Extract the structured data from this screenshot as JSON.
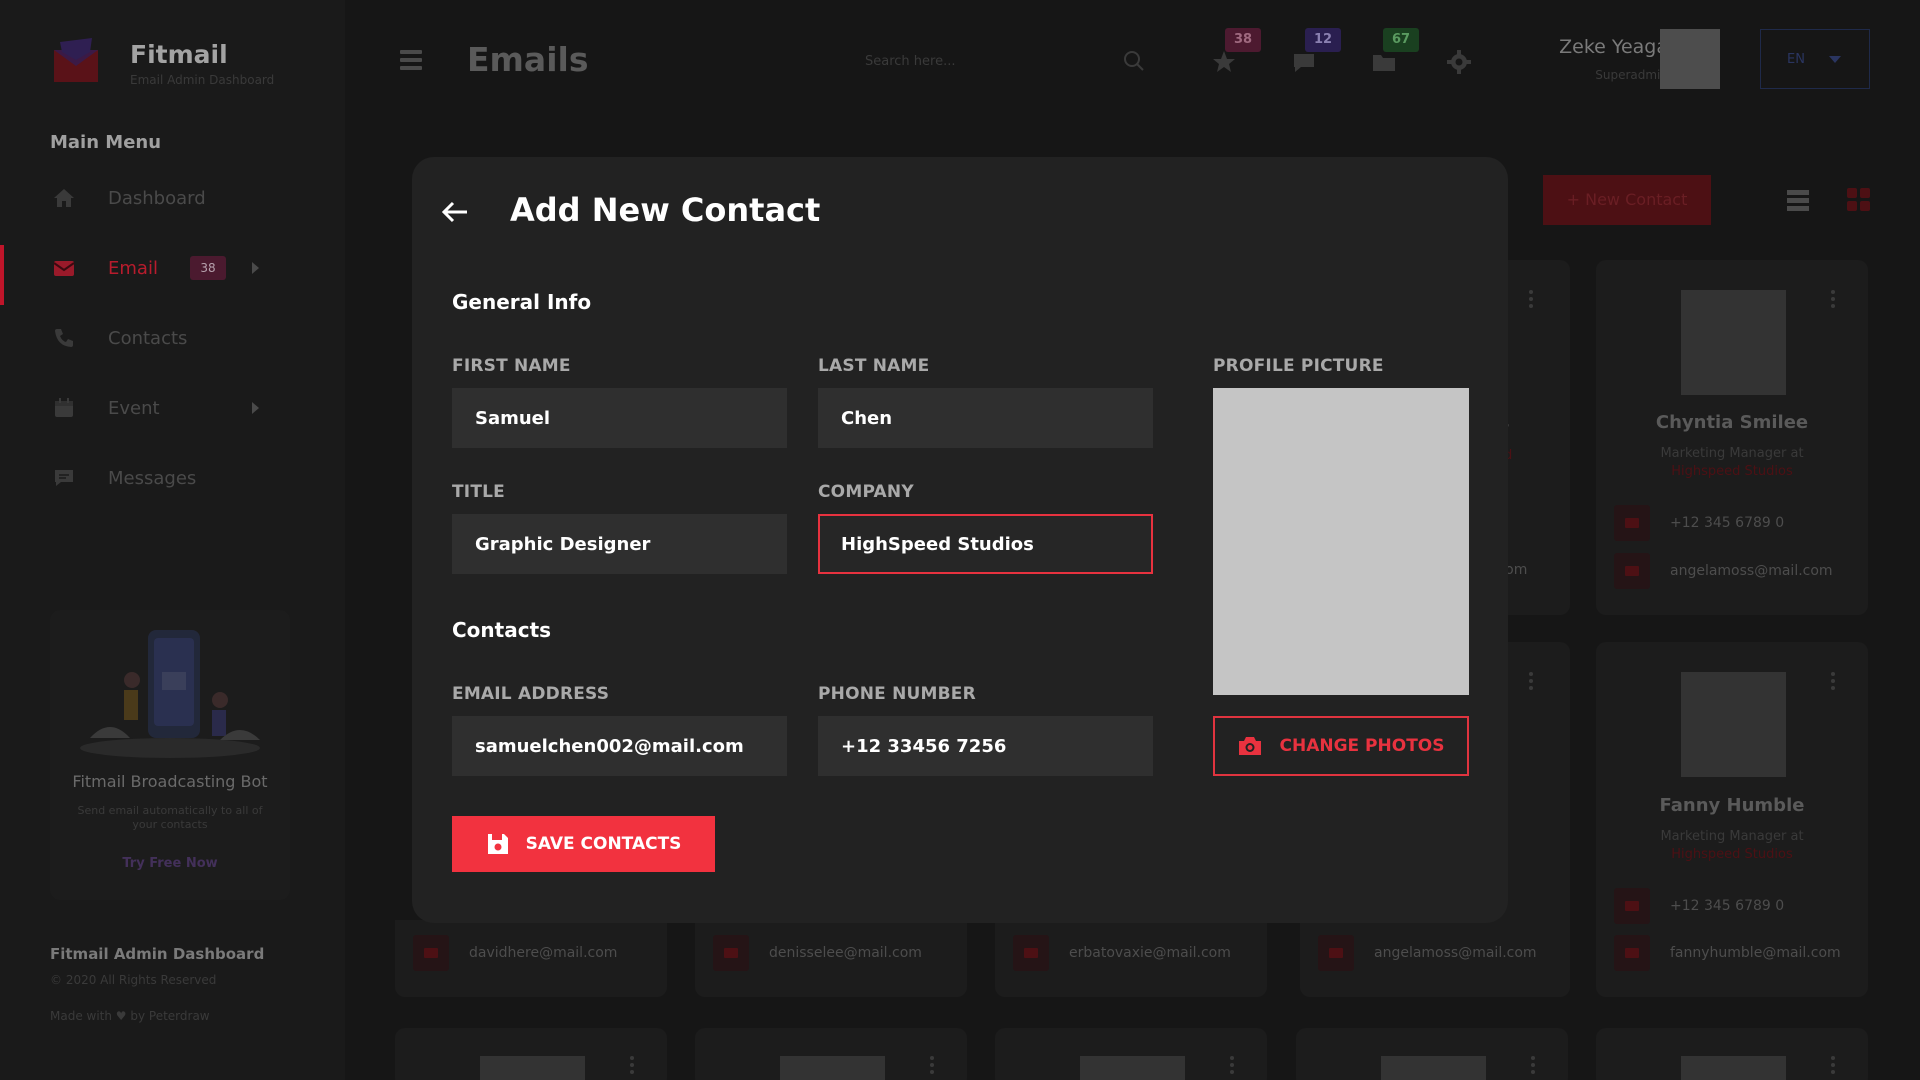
{
  "brand": {
    "name": "Fitmail",
    "subtitle": "Email Admin Dashboard"
  },
  "sidebar": {
    "menu_title": "Main Menu",
    "items": [
      {
        "label": "Dashboard",
        "icon": "home-icon"
      },
      {
        "label": "Email",
        "icon": "mail-icon",
        "badge": "38",
        "active": true
      },
      {
        "label": "Contacts",
        "icon": "phone-icon"
      },
      {
        "label": "Event",
        "icon": "calendar-icon"
      },
      {
        "label": "Messages",
        "icon": "chat-icon"
      }
    ],
    "promo": {
      "title": "Fitmail Broadcasting Bot",
      "text": "Send email automatically to all of your contacts",
      "link": "Try Free Now"
    },
    "footer": {
      "title": "Fitmail Admin Dashboard",
      "copyright": "© 2020 All Rights Reserved",
      "made": "Made with ♥ by Peterdraw"
    }
  },
  "header": {
    "title": "Emails",
    "search_placeholder": "Search here...",
    "badges": {
      "star": "38",
      "chat": "12",
      "folder": "67"
    },
    "user": {
      "name": "Zeke Yeaga",
      "role": "Superadmin"
    },
    "language": "EN"
  },
  "background": {
    "new_contact_label": "+ New Contact",
    "cards": [
      {
        "name": "Chyntia Smilee",
        "job": "Marketing Manager at",
        "company": "Highspeed Studios",
        "phone": "+12 345 6789 0",
        "email": "angelamoss@mail.com"
      },
      {
        "name": "Fanny Humble",
        "job": "Marketing Manager at",
        "company": "Highspeed Studios",
        "phone": "+12 345 6789 0",
        "email": "fannyhumble@mail.com"
      }
    ],
    "bottom_emails": [
      "davidhere@mail.com",
      "denisselee@mail.com",
      "erbatovaxie@mail.com",
      "angelamoss@mail.com"
    ],
    "partial_text": {
      "s": "s",
      "ed": "ed",
      "com": ".com"
    }
  },
  "modal": {
    "title": "Add New Contact",
    "general_title": "General Info",
    "contacts_title": "Contacts",
    "labels": {
      "first_name": "FIRST NAME",
      "last_name": "LAST NAME",
      "title": "TITLE",
      "company": "COMPANY",
      "email": "EMAIL ADDRESS",
      "phone": "PHONE NUMBER",
      "profile": "PROFILE PICTURE"
    },
    "values": {
      "first_name": "Samuel",
      "last_name": "Chen",
      "title": "Graphic Designer",
      "company": "HighSpeed Studios",
      "email": "samuelchen002@mail.com",
      "phone": "+12 33456 7256"
    },
    "change_photos": "CHANGE PHOTOS",
    "save": "SAVE CONTACTS"
  },
  "colors": {
    "accent": "#f2323f",
    "background": "#161616",
    "modal": "#222222"
  }
}
